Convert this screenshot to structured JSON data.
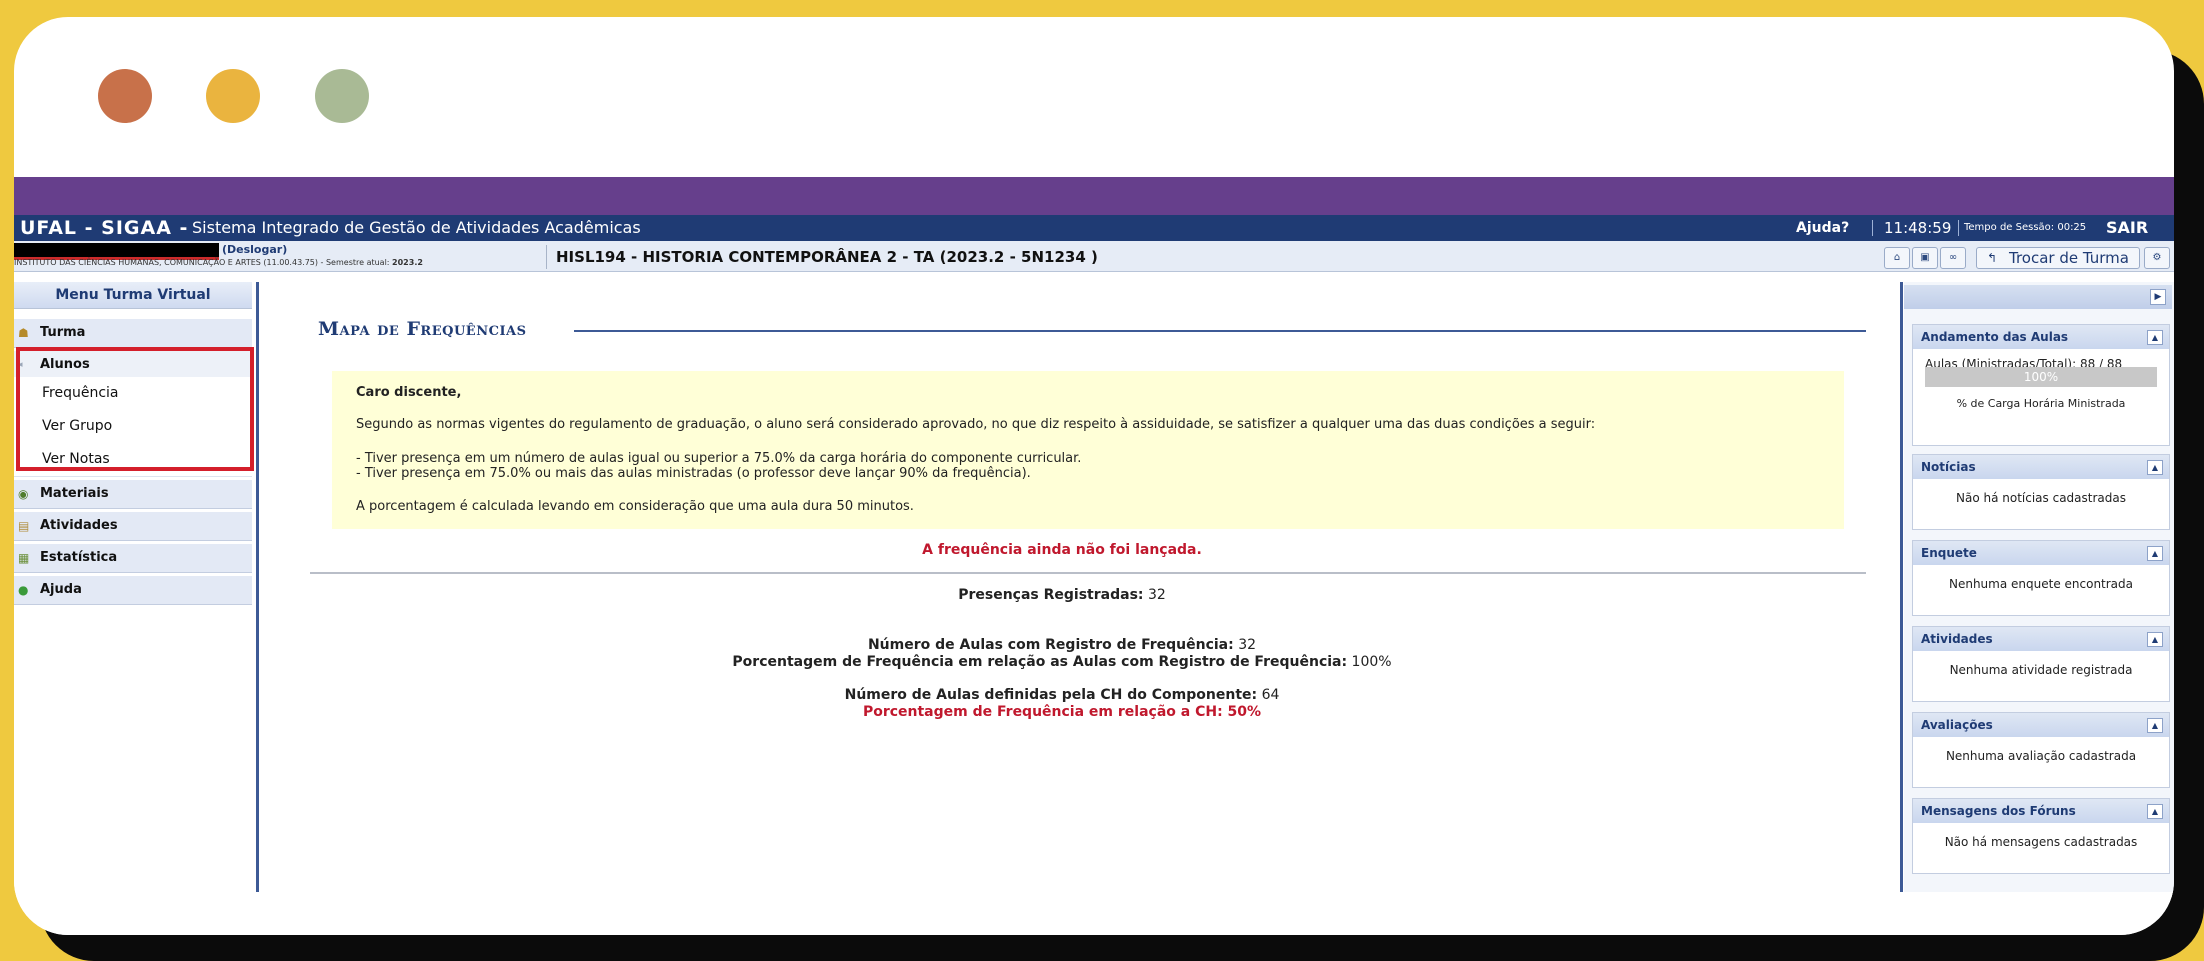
{
  "window_controls": {
    "colors": [
      "#C8714A",
      "#EAB43F",
      "#A9BA95"
    ],
    "icons": [
      "close-dot-icon",
      "minimize-dot-icon",
      "maximize-dot-icon"
    ]
  },
  "topbar": {
    "brand": "UFAL - SIGAA -",
    "system": "Sistema Integrado de Gestão de Atividades Acadêmicas",
    "help": "Ajuda?",
    "clock": "11:48:59",
    "session": "Tempo de Sessão: 00:25",
    "exit": "SAIR"
  },
  "infobar": {
    "logout": "(Deslogar)",
    "institute": "INSTITUTO DAS CIÊNCIAS HUMANAS, COMUNICAÇÃO E ARTES (11.00.43.75) - Semestre atual:",
    "semester": "2023.2",
    "class_title": "HISL194 - HISTORIA CONTEMPORÂNEA 2 - TA (2023.2 - 5N1234 )",
    "switch_class": "Trocar de Turma"
  },
  "menu": {
    "title": "Menu Turma Virtual",
    "turma": "Turma",
    "alunos": "Alunos",
    "sub": [
      "Frequência",
      "Ver Grupo",
      "Ver Notas"
    ],
    "materiais": "Materiais",
    "atividades": "Atividades",
    "estatistica": "Estatística",
    "ajuda": "Ajuda"
  },
  "main": {
    "title": "Mapa de Frequências",
    "notice": {
      "greeting": "Caro discente,",
      "intro": "Segundo as normas vigentes do regulamento de graduação, o aluno será considerado aprovado, no que diz respeito à assiduidade, se satisfizer a qualquer uma das duas condições a seguir:",
      "cond1": "- Tiver presença em um número de aulas igual ou superior a 75.0% da carga horária do componente curricular.",
      "cond2": "- Tiver presença em 75.0% ou mais das aulas ministradas (o professor deve lançar 90% da frequência).",
      "note": "A porcentagem é calculada levando em consideração que uma aula dura 50 minutos."
    },
    "alert": "A frequência ainda não foi lançada.",
    "presencas_label": "Presenças Registradas:",
    "presencas_value": "32",
    "aulas_reg_label": "Número de Aulas com Registro de Frequência:",
    "aulas_reg_value": "32",
    "pct_reg_label": "Porcentagem de Frequência em relação as Aulas com Registro de Frequência:",
    "pct_reg_value": "100%",
    "aulas_ch_label": "Número de Aulas definidas pela CH do Componente:",
    "aulas_ch_value": "64",
    "pct_ch": "Porcentagem de Frequência em relação a CH: 50%"
  },
  "right": {
    "andamento": {
      "title": "Andamento das Aulas",
      "line": "Aulas (Ministradas/Total): 88 / 88",
      "progress_label": "100%",
      "progress": 1.0,
      "caption": "% de Carga Horária Ministrada"
    },
    "noticias": {
      "title": "Notícias",
      "body": "Não há notícias cadastradas"
    },
    "enquete": {
      "title": "Enquete",
      "body": "Nenhuma enquete encontrada"
    },
    "atividades": {
      "title": "Atividades",
      "body": "Nenhuma atividade registrada"
    },
    "avaliacoes": {
      "title": "Avaliações",
      "body": "Nenhuma avaliação cadastrada"
    },
    "mensagens": {
      "title": "Mensagens dos Fóruns",
      "body": "Não há mensagens cadastradas"
    }
  },
  "colors": {
    "background": "#EFC93F",
    "header_purple": "#663F8C",
    "sigaa_blue": "#1F3B74",
    "alert_red": "#C0182D",
    "highlight_box": "#D41F2B"
  }
}
